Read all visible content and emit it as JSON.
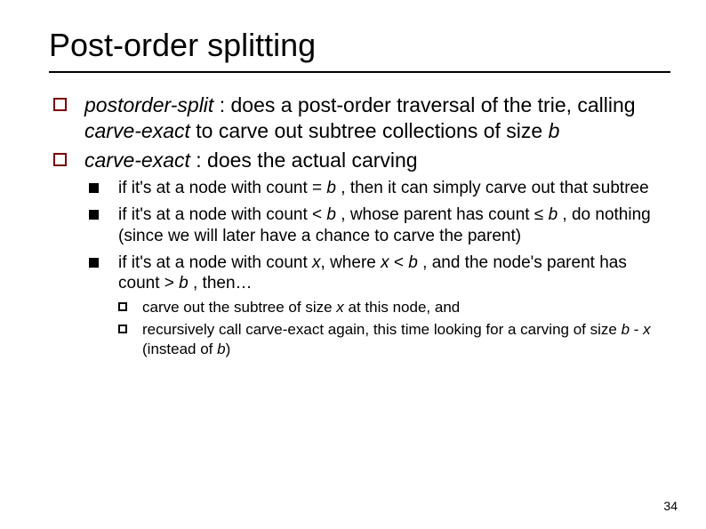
{
  "title": "Post-order splitting",
  "bullets": {
    "b1": {
      "term": "postorder-split",
      "sep": " : does a post-order traversal of the trie, calling ",
      "term2": "carve-exact",
      "rest1": "  to carve out subtree collections of size ",
      "var": "b"
    },
    "b2": {
      "term": "carve-exact",
      "rest": " : does the actual carving"
    },
    "s1": {
      "t1": "if it's at a node with count = ",
      "v1": "b",
      "t2": " , then it can simply carve out that subtree"
    },
    "s2": {
      "t1": "if it's at a node with count < ",
      "v1": "b",
      "t2": " , whose parent has count ≤ ",
      "v2": "b",
      "t3": " , do nothing (since we will later have a chance to carve the parent)"
    },
    "s3": {
      "t1": "if it's at a node with count ",
      "v1": "x",
      "t2": ", where ",
      "v2": "x",
      "t3": " < ",
      "v3": "b",
      "t4": " , and the node's parent has count > ",
      "v4": "b",
      "t5": " , then…"
    },
    "ss1": {
      "t1": "carve out the subtree of size ",
      "v1": "x",
      "t2": "  at this node, and"
    },
    "ss2": {
      "t1": "recursively call carve-exact again, this time looking for a carving of size ",
      "v1": "b",
      "t2": " - ",
      "v2": "x",
      "t3": " (instead of ",
      "v3": "b",
      "t4": ")"
    }
  },
  "page_number": "34"
}
